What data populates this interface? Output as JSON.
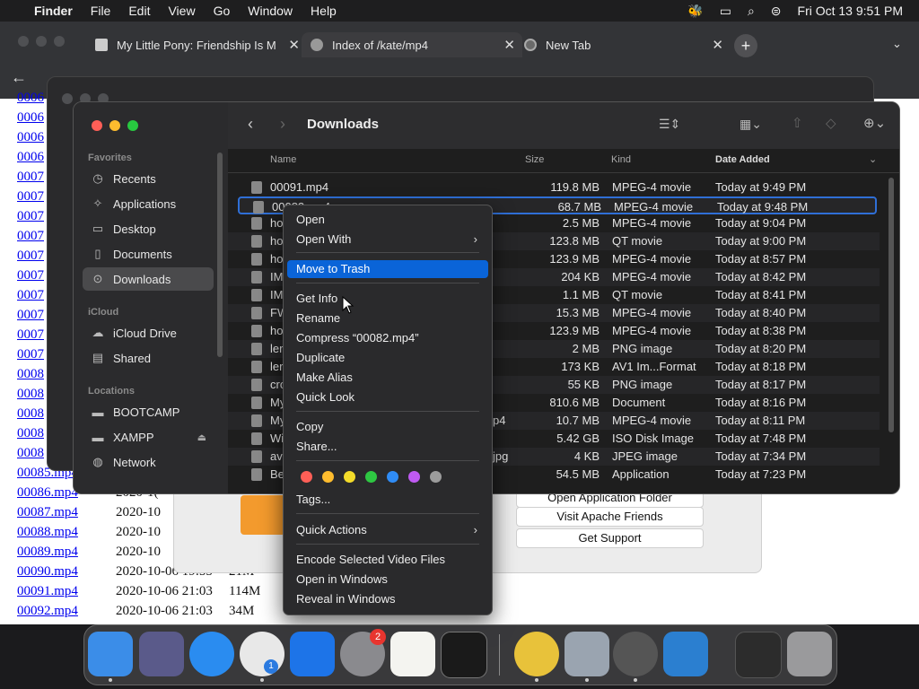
{
  "menubar": {
    "apple": "",
    "app": "Finder",
    "items": [
      "File",
      "Edit",
      "View",
      "Go",
      "Window",
      "Help"
    ],
    "datetime": "Fri Oct 13  9:51 PM"
  },
  "browser": {
    "tabs": [
      {
        "title": "My Little Pony: Friendship Is M"
      },
      {
        "title": "Index of /kate/mp4"
      },
      {
        "title": "New Tab"
      }
    ]
  },
  "webpage": {
    "links": [
      "0006",
      "0006",
      "0006",
      "0006",
      "0007",
      "0007",
      "0007",
      "0007",
      "0007",
      "0007",
      "0007",
      "0007",
      "0007",
      "0007",
      "0008",
      "0008",
      "0008",
      "0008",
      "0008",
      "00085.mp4",
      "00086.mp4",
      "00087.mp4",
      "00088.mp4",
      "00089.mp4",
      "00090.mp4",
      "00091.mp4",
      "00092.mp4"
    ],
    "rows": [
      {
        "date": "2020-1(",
        "size": ""
      },
      {
        "date": "2020-10",
        "size": ""
      },
      {
        "date": "2020-10",
        "size": ""
      },
      {
        "date": "2020-10",
        "size": ""
      },
      {
        "date": "2020-10-06 19:55",
        "size": "21M"
      },
      {
        "date": "2020-10-06 21:03",
        "size": "114M"
      },
      {
        "date": "2020-10-06 21:03",
        "size": "34M"
      }
    ]
  },
  "xampp": {
    "buttons": [
      "Open Application Folder",
      "Visit Apache Friends",
      "Get Support"
    ]
  },
  "finder": {
    "title": "Downloads",
    "sidebar": {
      "favorites_label": "Favorites",
      "favorites": [
        "Recents",
        "Applications",
        "Desktop",
        "Documents",
        "Downloads"
      ],
      "icloud_label": "iCloud",
      "icloud": [
        "iCloud Drive",
        "Shared"
      ],
      "locations_label": "Locations",
      "locations": [
        "BOOTCAMP",
        "XAMPP",
        "Network"
      ]
    },
    "columns": {
      "name": "Name",
      "size": "Size",
      "kind": "Kind",
      "date": "Date Added"
    },
    "files": [
      {
        "name": "00091.mp4",
        "size": "119.8 MB",
        "kind": "MPEG-4 movie",
        "date": "Today at 9:49 PM"
      },
      {
        "name": "00082.mp4",
        "size": "68.7 MB",
        "kind": "MPEG-4 movie",
        "date": "Today at 9:48 PM"
      },
      {
        "name": "ho",
        "size": "2.5 MB",
        "kind": "MPEG-4 movie",
        "date": "Today at 9:04 PM"
      },
      {
        "name": "ho",
        "size": "123.8 MB",
        "kind": "QT movie",
        "date": "Today at 9:00 PM"
      },
      {
        "name": "ho",
        "size": "123.9 MB",
        "kind": "MPEG-4 movie",
        "date": "Today at 8:57 PM"
      },
      {
        "name": "IM",
        "size": "204 KB",
        "kind": "MPEG-4 movie",
        "date": "Today at 8:42 PM"
      },
      {
        "name": "IM",
        "size": "1.1 MB",
        "kind": "QT movie",
        "date": "Today at 8:41 PM"
      },
      {
        "name": "FW",
        "size": "15.3 MB",
        "kind": "MPEG-4 movie",
        "date": "Today at 8:40 PM"
      },
      {
        "name": "ho",
        "size": "123.9 MB",
        "kind": "MPEG-4 movie",
        "date": "Today at 8:38 PM"
      },
      {
        "name": "ler",
        "size": "2 MB",
        "kind": "PNG image",
        "date": "Today at 8:20 PM"
      },
      {
        "name": "ler",
        "size": "173 KB",
        "kind": "AV1 Im...Format",
        "date": "Today at 8:18 PM"
      },
      {
        "name": "cro",
        "size": "55 KB",
        "kind": "PNG image",
        "date": "Today at 8:17 PM"
      },
      {
        "name": "My",
        "size": "810.6 MB",
        "kind": "Document",
        "date": "Today at 8:16 PM"
      },
      {
        "name": "My",
        "size": "10.7 MB",
        "kind": "MPEG-4 movie",
        "date": "Today at 8:11 PM"
      },
      {
        "name": "Wi",
        "size": "5.42 GB",
        "kind": "ISO Disk Image",
        "date": "Today at 7:48 PM"
      },
      {
        "name": "ava",
        "size": "4 KB",
        "kind": "JPEG image",
        "date": "Today at 7:34 PM"
      },
      {
        "name": "Be",
        "size": "54.5 MB",
        "kind": "Application",
        "date": "Today at 7:23 PM"
      }
    ],
    "name_suffixes": {
      "row13": "p4",
      "row15": "jpg"
    }
  },
  "context_menu": {
    "items": {
      "open": "Open",
      "open_with": "Open With",
      "move_to_trash": "Move to Trash",
      "get_info": "Get Info",
      "rename": "Rename",
      "compress": "Compress “00082.mp4”",
      "duplicate": "Duplicate",
      "make_alias": "Make Alias",
      "quick_look": "Quick Look",
      "copy": "Copy",
      "share": "Share...",
      "tags": "Tags...",
      "quick_actions": "Quick Actions",
      "encode": "Encode Selected Video Files",
      "open_windows": "Open in Windows",
      "reveal_windows": "Reveal in Windows"
    },
    "tag_colors": [
      "#ff5f57",
      "#febc2e",
      "#f4dc2a",
      "#2ec742",
      "#2f8cf6",
      "#bf5af2",
      "#9c9c9c"
    ]
  },
  "dock": {
    "badge": "2",
    "chrome_badge": "1"
  }
}
